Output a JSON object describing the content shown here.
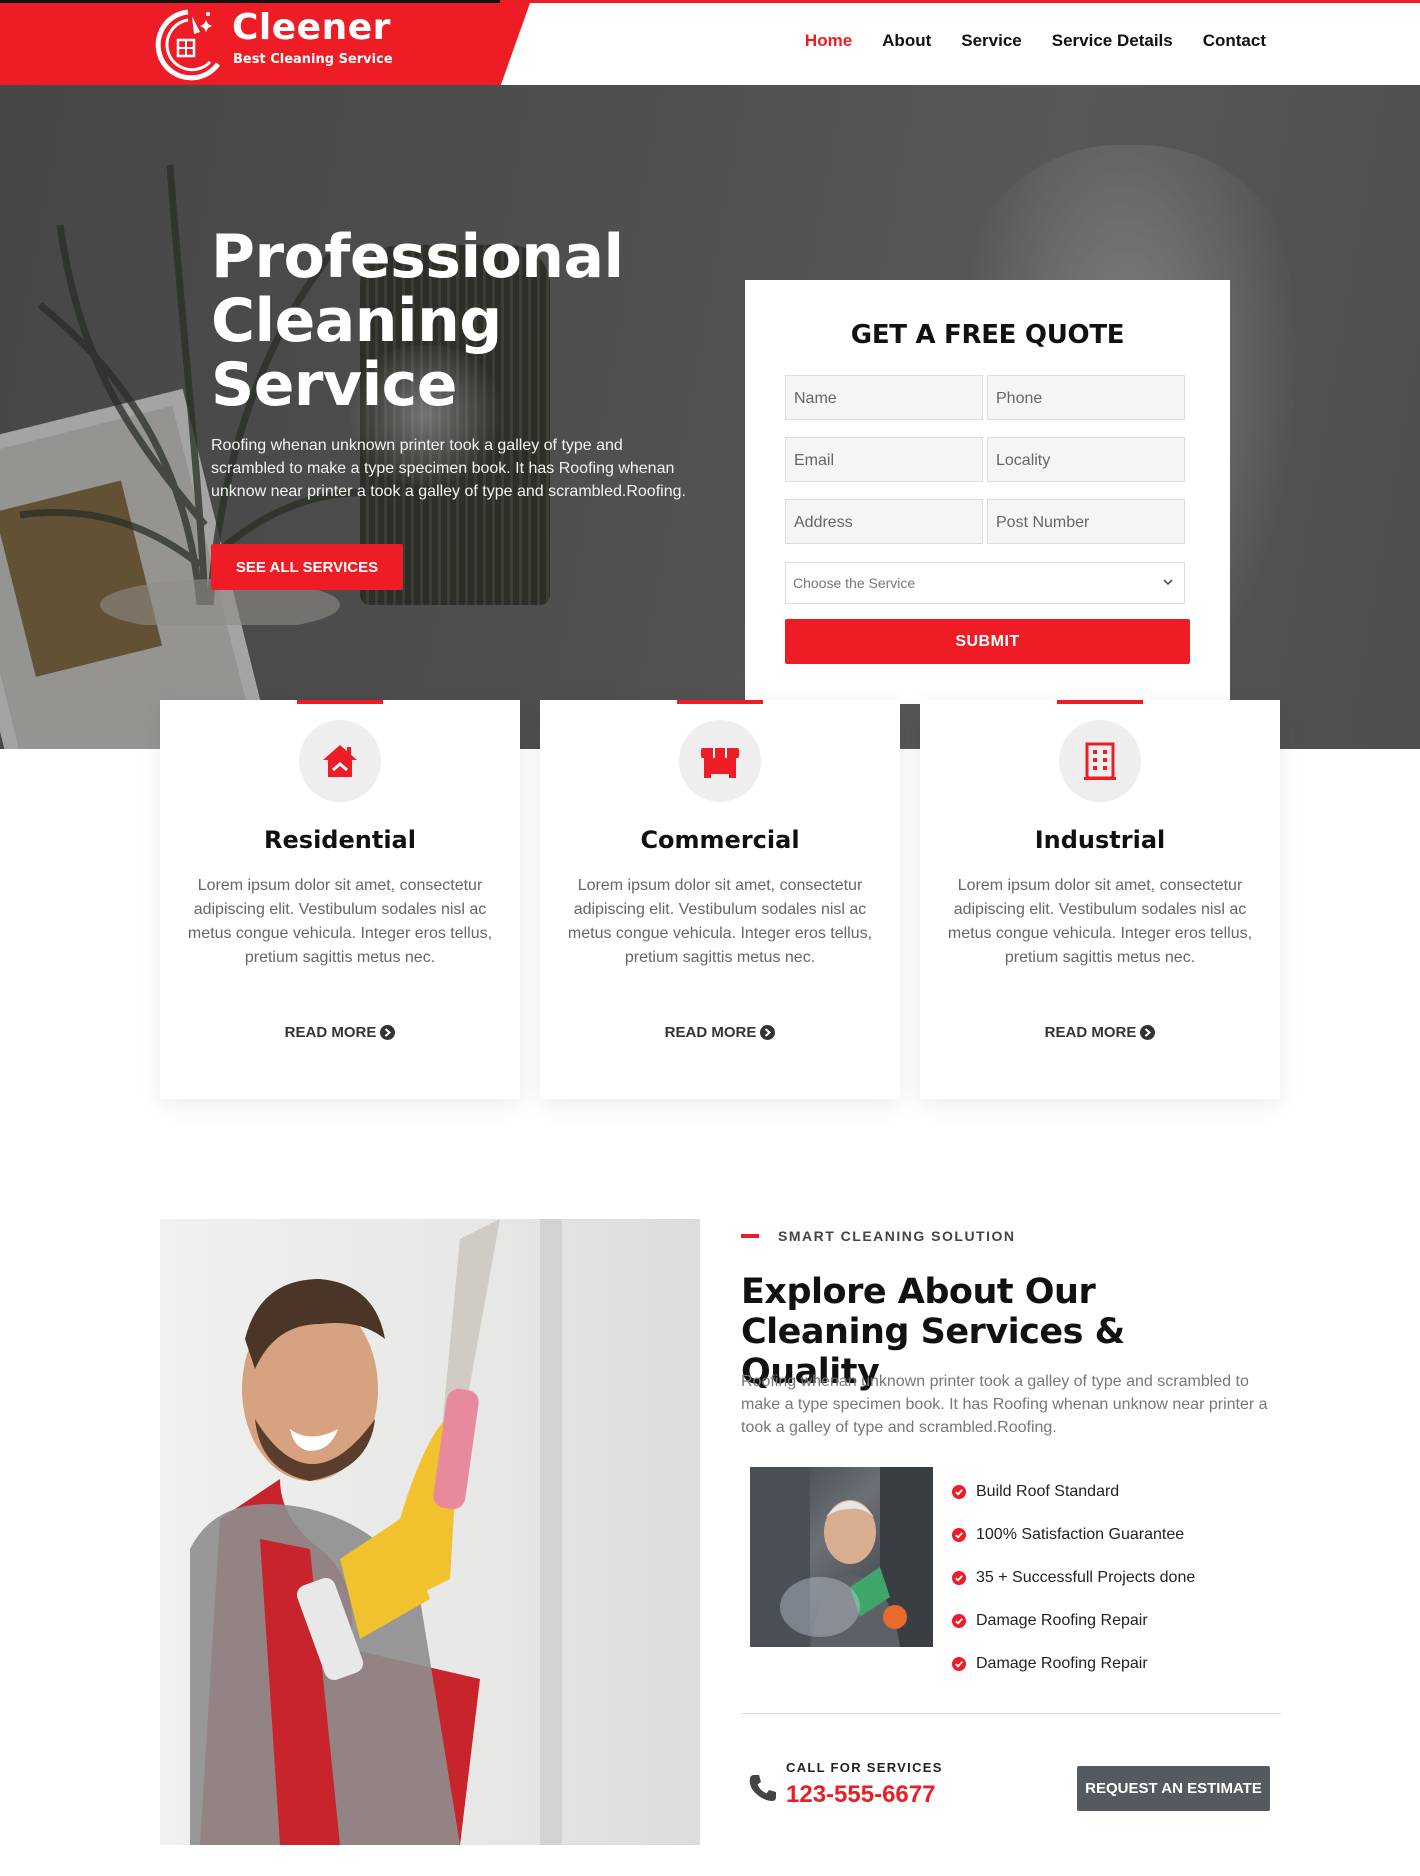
{
  "brand": {
    "name": "Cleener",
    "tagline": "Best Cleaning Service"
  },
  "nav": {
    "items": [
      {
        "label": "Home",
        "active": true
      },
      {
        "label": "About",
        "active": false
      },
      {
        "label": "Service",
        "active": false
      },
      {
        "label": "Service Details",
        "active": false
      },
      {
        "label": "Contact",
        "active": false
      }
    ]
  },
  "hero": {
    "title": "Professional Cleaning Service",
    "text": "Roofing whenan unknown printer took a galley of type and scrambled to make a type specimen book. It has Roofing whenan unknow near printer a took a galley of type and scrambled.Roofing.",
    "button_label": "SEE ALL SERVICES"
  },
  "quote_form": {
    "title": "GET A FREE QUOTE",
    "fields": {
      "name": "Name",
      "phone": "Phone",
      "email": "Email",
      "locality": "Locality",
      "address": "Address",
      "post_number": "Post Number"
    },
    "service_select": "Choose the Service",
    "submit_label": "SUBMIT"
  },
  "services": [
    {
      "title": "Residential",
      "icon": "house-icon",
      "text": "Lorem ipsum dolor sit amet, consectetur adipiscing elit. Vestibulum sodales nisl ac metus congue vehicula. Integer eros tellus, pretium sagittis metus nec.",
      "link": "READ MORE"
    },
    {
      "title": "Commercial",
      "icon": "storefront-icon",
      "text": "Lorem ipsum dolor sit amet, consectetur adipiscing elit. Vestibulum sodales nisl ac metus congue vehicula. Integer eros tellus, pretium sagittis metus nec.",
      "link": "READ MORE"
    },
    {
      "title": "Industrial",
      "icon": "building-icon",
      "text": "Lorem ipsum dolor sit amet, consectetur adipiscing elit. Vestibulum sodales nisl ac metus congue vehicula. Integer eros tellus, pretium sagittis metus nec.",
      "link": "READ MORE"
    }
  ],
  "about": {
    "eyebrow": "SMART CLEANING SOLUTION",
    "title": "Explore About Our Cleaning Services & Quality",
    "text": "Roofing whenan unknown printer took a galley of type and scrambled to make a type specimen book. It has Roofing whenan unknow near printer a took a galley of type and scrambled.Roofing.",
    "checklist": [
      "Build Roof Standard",
      "100% Satisfaction Guarantee",
      "35 + Successfull Projects done",
      "Damage Roofing Repair",
      "Damage Roofing Repair"
    ],
    "call_label": "CALL FOR SERVICES",
    "phone": "123-555-6677",
    "estimate_button": "REQUEST AN ESTIMATE"
  },
  "colors": {
    "accent": "#ee1c25",
    "dark_button": "#555a60",
    "text_muted": "#666666"
  }
}
